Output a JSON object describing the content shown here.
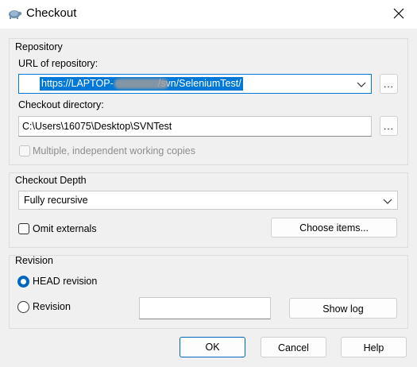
{
  "window": {
    "title": "Checkout",
    "app_icon": "tortoise-svn-icon",
    "close_icon": "close-icon"
  },
  "repository": {
    "group_title": "Repository",
    "url_label": "URL of repository:",
    "url_value": "https://LAPTOP-",
    "url_value_tail": "/svn/SeleniumTest/",
    "url_browse_label": "...",
    "dir_label": "Checkout directory:",
    "dir_value": "C:\\Users\\16075\\Desktop\\SVNTest",
    "dir_browse_label": "...",
    "multiple_label": "Multiple, independent working copies",
    "multiple_checked": false
  },
  "depth": {
    "group_title": "Checkout Depth",
    "selected": "Fully recursive",
    "omit_externals_label": "Omit externals",
    "omit_externals_checked": false,
    "choose_items_label": "Choose items..."
  },
  "revision": {
    "group_title": "Revision",
    "head_label": "HEAD revision",
    "revision_label": "Revision",
    "selected": "HEAD revision",
    "revision_value": "",
    "show_log_label": "Show log"
  },
  "buttons": {
    "ok": "OK",
    "cancel": "Cancel",
    "help": "Help"
  },
  "colors": {
    "accent": "#0078d7",
    "selection": "#0078d7"
  }
}
